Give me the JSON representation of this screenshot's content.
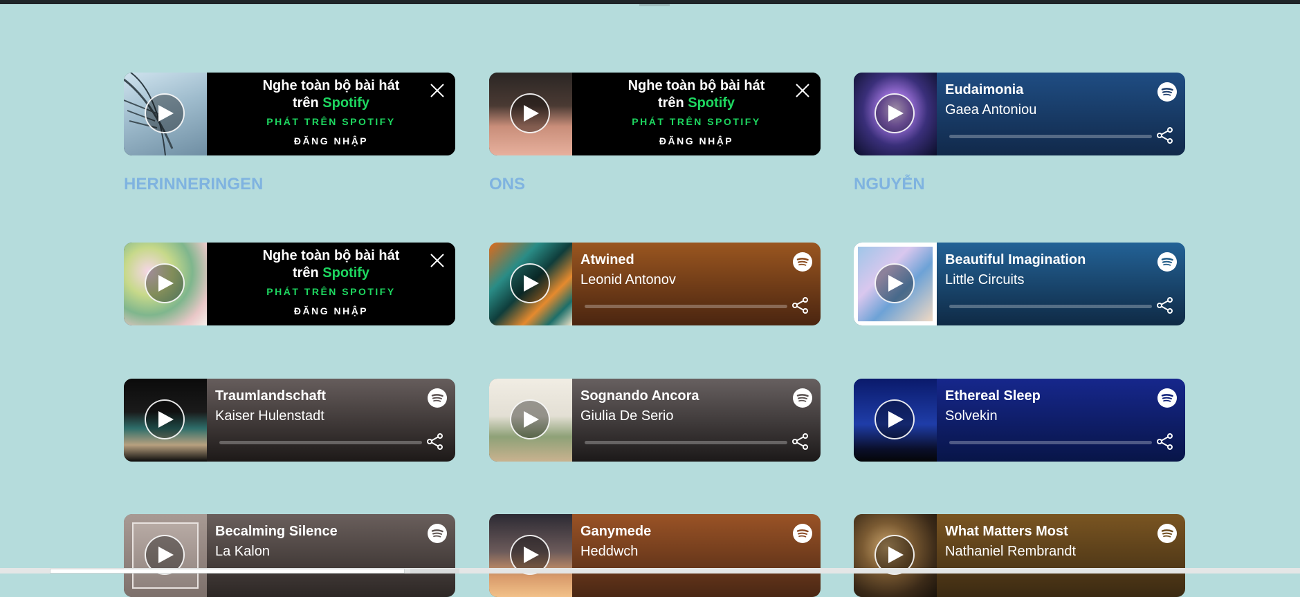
{
  "promo": {
    "line1": "Nghe toàn bộ bài hát",
    "line2_prefix": "trên ",
    "line2_brand": "Spotify",
    "play_label": "PHÁT TRÊN SPOTIFY",
    "login_label": "ĐĂNG NHẬP"
  },
  "headings": [
    "HERINNERINGEN",
    "ONS",
    "NGUYỄN"
  ],
  "tracks": [
    {
      "title": "Eudaimonia",
      "artist": "Gaea Antoniou",
      "color": "#1b3b6a"
    },
    {
      "title": "Atwined",
      "artist": "Leonid Antonov",
      "color": "#8a4a1c"
    },
    {
      "title": "Beautiful Imagination",
      "artist": "Little Circuits",
      "color": "#1f5a86"
    },
    {
      "title": "Traumlandschaft",
      "artist": "Kaiser Hulenstadt",
      "color": "#5b5151"
    },
    {
      "title": "Sognando Ancora",
      "artist": "Giulia De Serio",
      "color": "#5a5251"
    },
    {
      "title": "Ethereal Sleep",
      "artist": "Solvekin",
      "color": "#0d1f78"
    },
    {
      "title": "Becalming Silence",
      "artist": "La Kalon",
      "color": "#5d5350"
    },
    {
      "title": "Ganymede",
      "artist": "Heddwch",
      "color": "#8a4a26"
    },
    {
      "title": "What Matters Most",
      "artist": "Nathaniel Rembrandt",
      "color": "#6e4c1e"
    }
  ],
  "colors": {
    "spotify_green": "#1ed760",
    "page_bg": "#b5dcdc",
    "heading": "#7fb3e0"
  }
}
